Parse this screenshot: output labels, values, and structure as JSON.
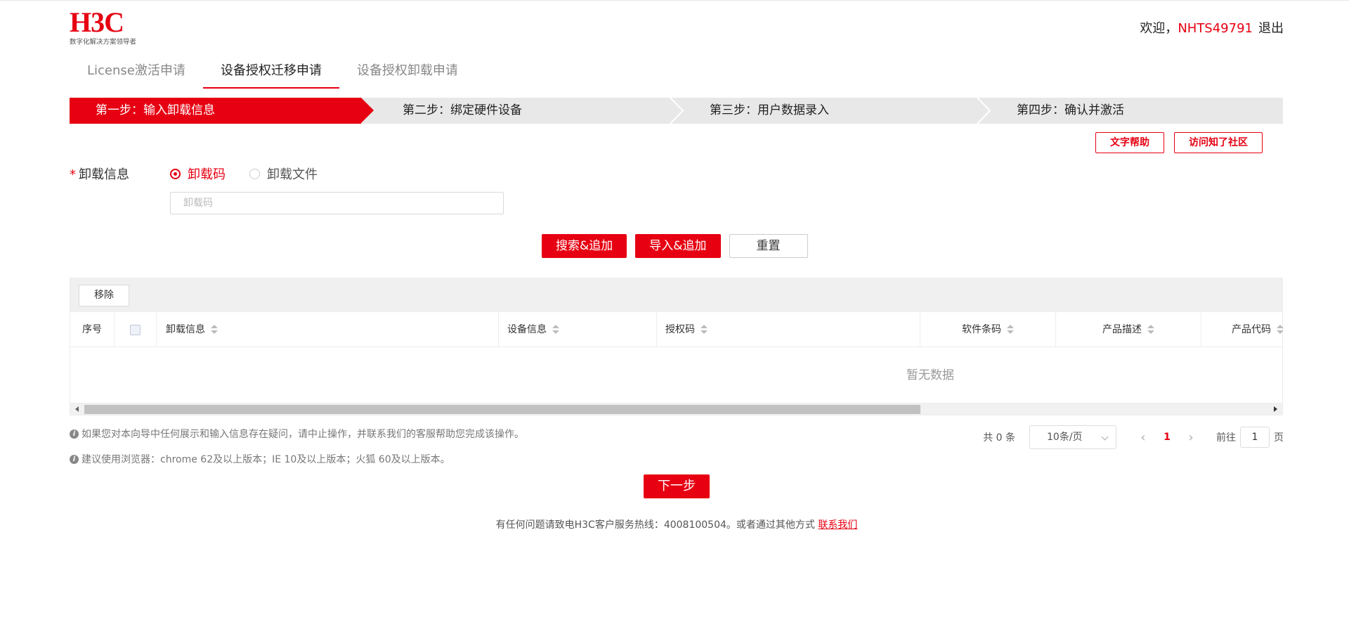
{
  "header": {
    "logo_text": "H3C",
    "logo_slogan": "数字化解决方案领导者",
    "welcome": "欢迎，",
    "username": "NHTS49791",
    "logout": "退出"
  },
  "tabs": [
    {
      "label": "License激活申请",
      "active": false
    },
    {
      "label": "设备授权迁移申请",
      "active": true
    },
    {
      "label": "设备授权卸载申请",
      "active": false
    }
  ],
  "steps": [
    {
      "label": "第一步：输入卸载信息",
      "active": true
    },
    {
      "label": "第二步：绑定硬件设备",
      "active": false
    },
    {
      "label": "第三步：用户数据录入",
      "active": false
    },
    {
      "label": "第四步：确认并激活",
      "active": false
    }
  ],
  "help": {
    "text_help": "文字帮助",
    "community": "访问知了社区"
  },
  "form": {
    "label": "卸载信息",
    "required_mark": "*",
    "options": [
      {
        "label": "卸载码",
        "selected": true
      },
      {
        "label": "卸载文件",
        "selected": false
      }
    ],
    "input_value": "",
    "input_placeholder": "卸载码"
  },
  "actions": {
    "search_add": "搜索&追加",
    "import_add": "导入&追加",
    "reset": "重置"
  },
  "table": {
    "remove": "移除",
    "columns": [
      "序号",
      "卸载信息",
      "设备信息",
      "授权码",
      "软件条码",
      "产品描述",
      "产品代码"
    ],
    "rows": [],
    "empty_text": "暂无数据"
  },
  "notes": [
    "如果您对本向导中任何展示和输入信息存在疑问，请中止操作，并联系我们的客服帮助您完成该操作。",
    "建议使用浏览器：chrome 62及以上版本；IE 10及以上版本；火狐 60及以上版本。"
  ],
  "pagination": {
    "total": "共 0 条",
    "page_size": "10条/页",
    "prev": "‹",
    "current_page": "1",
    "next": "›",
    "goto_label": "前往",
    "goto_value": "1",
    "page_unit": "页"
  },
  "next_button": "下一步",
  "footer": {
    "text": "有任何问题请致电H3C客户服务热线：4008100504。或者通过其他方式 ",
    "link": "联系我们"
  },
  "colors": {
    "brand": "#e60012"
  }
}
